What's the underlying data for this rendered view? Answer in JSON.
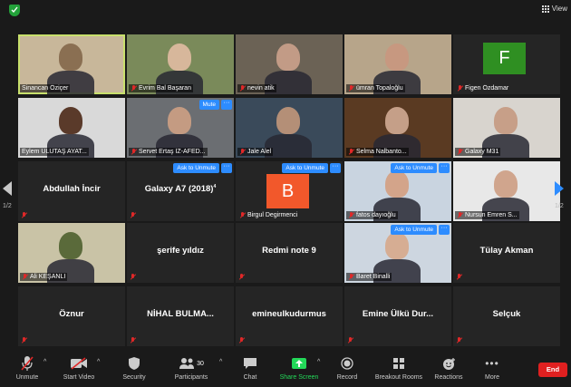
{
  "topbar": {
    "view_label": "View"
  },
  "gallery": {
    "rows": [
      [
        {
          "name": "Sinancan Öziçer",
          "type": "video",
          "active": true
        },
        {
          "name": "Evrim Bal Başaran",
          "type": "video",
          "muted": true
        },
        {
          "name": "nevin atik",
          "type": "video",
          "muted": true
        },
        {
          "name": "ümran Topaloğlu",
          "type": "video",
          "muted": true
        },
        {
          "name": "Figen Özdamar",
          "type": "avatar",
          "initial": "F",
          "muted": true
        }
      ],
      [
        {
          "name": "Eylem ULUTAŞ AYAT...",
          "type": "video"
        },
        {
          "name": "Servet Ertaş İZ-AFED...",
          "type": "video",
          "muted": true,
          "button": "Mute"
        },
        {
          "name": "Jale Alel",
          "type": "video",
          "muted": true
        },
        {
          "name": "Selma Nalbanto...",
          "type": "video",
          "muted": true
        },
        {
          "name": "Galaxy M31",
          "type": "video",
          "muted": true
        }
      ],
      [
        {
          "name": "Abdullah İncir",
          "type": "name",
          "muted": true
        },
        {
          "name": "Galaxy A7 (2018)",
          "type": "name",
          "muted": true,
          "button": "Ask to Unmute",
          "superscript": "4"
        },
        {
          "name": "Birgul Degirmenci",
          "type": "avatar",
          "initial": "B",
          "muted": true,
          "button": "Ask to Unmute"
        },
        {
          "name": "fatos dayıoğlu",
          "type": "video",
          "muted": true,
          "button": "Ask to Unmute"
        },
        {
          "name": "Nursun Emren S...",
          "type": "video",
          "muted": true
        }
      ],
      [
        {
          "name": "Ali KEŞANLI",
          "type": "video",
          "muted": true
        },
        {
          "name": "şerife yıldız",
          "type": "name",
          "muted": true
        },
        {
          "name": "Redmi note 9",
          "type": "name",
          "muted": true
        },
        {
          "name": "Baret Binalli",
          "type": "video",
          "muted": true,
          "button": "Ask to Unmute"
        },
        {
          "name": "Tülay Akman",
          "type": "name",
          "muted": true
        }
      ],
      [
        {
          "name": "Öznur",
          "type": "name",
          "muted": true
        },
        {
          "name": "NİHAL BULMA...",
          "type": "name",
          "muted": true
        },
        {
          "name": "emineulkudurmus",
          "type": "name",
          "muted": true
        },
        {
          "name": "Emine Ülkü Dur...",
          "type": "name",
          "muted": true
        },
        {
          "name": "Selçuk",
          "type": "name",
          "muted": true
        }
      ]
    ],
    "more_label": "···",
    "page_left": "1/2",
    "page_right": "1/2"
  },
  "toolbar": {
    "unmute": "Unmute",
    "start_video": "Start Video",
    "security": "Security",
    "participants": "Participants",
    "participants_count": "30",
    "chat": "Chat",
    "share_screen": "Share Screen",
    "record": "Record",
    "breakout_rooms": "Breakout Rooms",
    "reactions": "Reactions",
    "more": "More",
    "end": "End"
  },
  "colors": {
    "accent_blue": "#2d8cff",
    "share_green": "#23d959",
    "end_red": "#e02020",
    "active_speaker": "#c8e06c"
  }
}
